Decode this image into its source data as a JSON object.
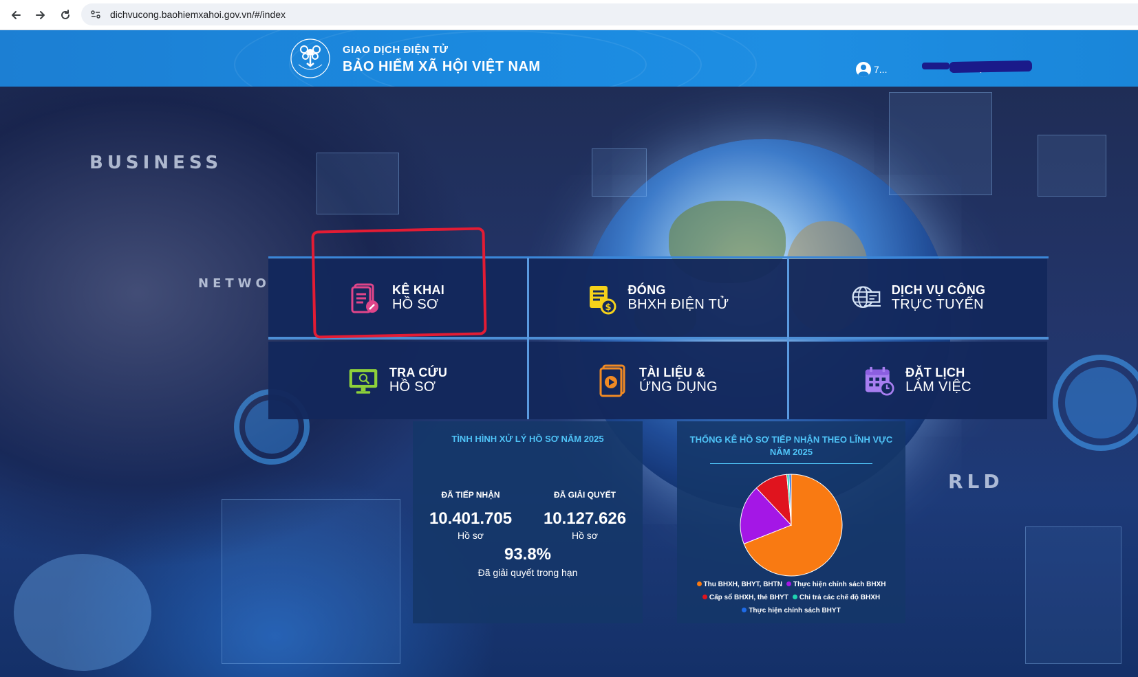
{
  "browser": {
    "url": "dichvucong.baohiemxahoi.gov.vn/#/index"
  },
  "header": {
    "brand_sub": "GIAO DỊCH ĐIỆN TỬ",
    "brand_main": "BẢO HIỂM XÃ HỘI VIỆT NAM",
    "logo_text": "BẢO HIỂM XÃ HỘI VIỆT NAM",
    "user_name": "7..."
  },
  "hero_labels": {
    "business": "BUSINESS",
    "network": "NETWO",
    "world": "RLD"
  },
  "tiles": [
    {
      "line1": "KÊ KHAI",
      "line2": "HỒ SƠ",
      "icon": "document-edit-icon",
      "color": "#e0458a"
    },
    {
      "line1": "ĐÓNG",
      "line2": "BHXH ĐIỆN TỬ",
      "icon": "payment-coin-icon",
      "color": "#f6d21a"
    },
    {
      "line1": "DỊCH VỤ CÔNG",
      "line2": "TRỰC TUYẾN",
      "icon": "globe-screen-icon",
      "color": "#d5e3f5"
    },
    {
      "line1": "TRA CỨU",
      "line2": "HỒ SƠ",
      "icon": "monitor-search-icon",
      "color": "#8ed13a"
    },
    {
      "line1": "TÀI LIỆU &",
      "line2": "ỨNG DỤNG",
      "icon": "book-video-icon",
      "color": "#f08a24"
    },
    {
      "line1": "ĐẶT LỊCH",
      "line2": "LÀM VIỆC",
      "icon": "calendar-clock-icon",
      "color": "#a77ef0"
    }
  ],
  "stats": {
    "title": "TÌNH HÌNH XỬ LÝ HỒ SƠ NĂM 2025",
    "received_label": "ĐÃ TIẾP NHẬN",
    "received_value": "10.401.705",
    "received_unit": "Hồ sơ",
    "resolved_label": "ĐÃ GIẢI QUYẾT",
    "resolved_value": "10.127.626",
    "resolved_unit": "Hồ sơ",
    "ontime_percent": "93.8%",
    "ontime_label": "Đã giải quyết trong hạn"
  },
  "chart_data": {
    "type": "pie",
    "title": "THỐNG KÊ HỒ SƠ TIẾP NHẬN THEO LĨNH VỰC NĂM 2025",
    "series": [
      {
        "name": "Thu BHXH, BHYT, BHTN",
        "value": 69.0,
        "color": "#f97a12"
      },
      {
        "name": "Thực hiện chính sách BHXH",
        "value": 19.0,
        "color": "#a417e6"
      },
      {
        "name": "Cấp sổ BHXH, thẻ BHYT",
        "value": 10.6,
        "color": "#e0141e"
      },
      {
        "name": "Chi trả các chế độ BHXH",
        "value": 0.7,
        "color": "#1fd4b0"
      },
      {
        "name": "Thực hiện chính sách BHYT",
        "value": 0.7,
        "color": "#1e6be8"
      }
    ],
    "legend_position": "bottom"
  }
}
